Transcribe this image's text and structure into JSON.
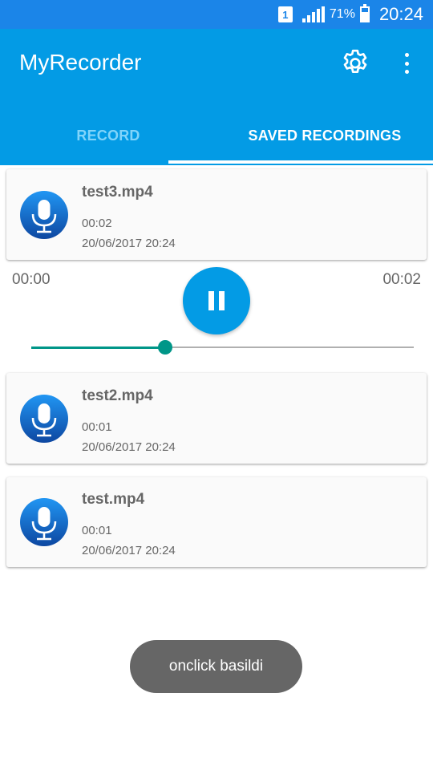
{
  "status_bar": {
    "sim_label": "1",
    "battery_percent": "71%",
    "battery_level": 0.71,
    "time": "20:24"
  },
  "app_bar": {
    "title": "MyRecorder",
    "settings_icon": "gear-icon",
    "overflow_icon": "more-vert-icon"
  },
  "tabs": [
    {
      "label": "RECORD",
      "selected": false
    },
    {
      "label": "SAVED RECORDINGS",
      "selected": true
    }
  ],
  "recordings": [
    {
      "name": "test3.mp4",
      "duration": "00:02",
      "date": "20/06/2017 20:24"
    },
    {
      "name": "test2.mp4",
      "duration": "00:01",
      "date": "20/06/2017 20:24"
    },
    {
      "name": "test.mp4",
      "duration": "00:01",
      "date": "20/06/2017 20:24"
    }
  ],
  "player": {
    "current_time": "00:00",
    "total_time": "00:02",
    "state_icon": "pause-icon",
    "progress": 0.35
  },
  "toast": {
    "message": "onclick basildi"
  },
  "colors": {
    "primary": "#039be5",
    "status_bar": "#1b85e8",
    "accent": "#009688",
    "tab_inactive": "#81d4fa",
    "toast_bg": "#666666"
  }
}
